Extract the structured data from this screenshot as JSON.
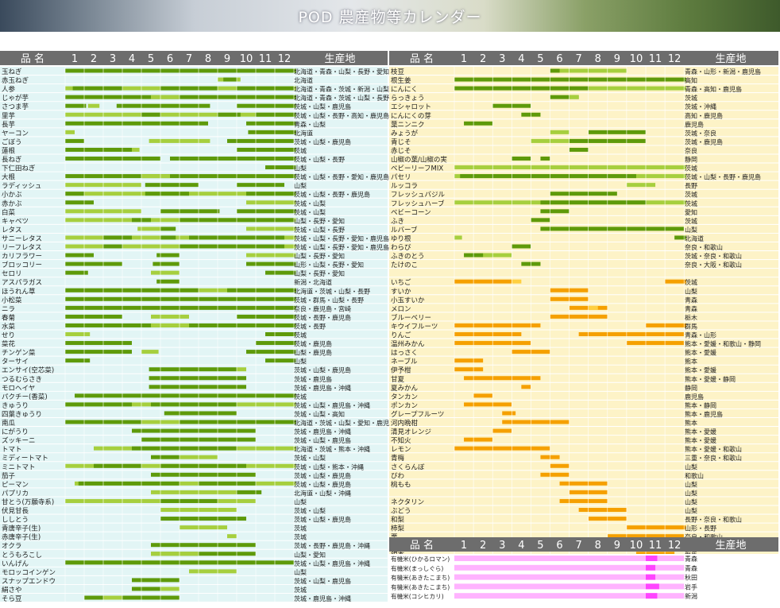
{
  "title": "POD 農産物等カレンダー",
  "headers": {
    "item": "品 名",
    "months": [
      "1",
      "2",
      "3",
      "4",
      "5",
      "6",
      "7",
      "8",
      "9",
      "10",
      "11",
      "12"
    ],
    "origin": "生産地"
  },
  "colors": {
    "dark": "#5e9a0a",
    "light": "#a6cf3e",
    "orange_dark": "#f5a000",
    "orange_light": "#ffcf40",
    "pink": "#ff44ff",
    "pink_stripe": "#ffb3ff",
    "header_bg": "#6d6d6d",
    "teal_row": "#e2f5f5",
    "cream_row": "#fdf3c7"
  },
  "left": [
    {
      "name": "玉ねぎ",
      "origin": "北海道・青森・山梨・長野・愛知・鹿児島"
    },
    {
      "name": "赤玉ねぎ",
      "origin": "北海道"
    },
    {
      "name": "人参",
      "origin": "北海道・青森・茨城・新潟・山梨・長野・鹿児島"
    },
    {
      "name": "じゃが芋",
      "origin": "北海道・青森・茨城・山梨・長野・愛知・鹿児島"
    },
    {
      "name": "さつま芋",
      "origin": "茨城・山梨・鹿児島"
    },
    {
      "name": "里芋",
      "origin": "茨城・山梨・長野・高知・鹿児島"
    },
    {
      "name": "長芋",
      "origin": "青森・山梨"
    },
    {
      "name": "ヤーコン",
      "origin": "北海道"
    },
    {
      "name": "ごぼう",
      "origin": "茨城・山梨・鹿児島"
    },
    {
      "name": "蓮根",
      "origin": "茨城"
    },
    {
      "name": "長ねぎ",
      "origin": "茨城・山梨・長野"
    },
    {
      "name": "下仁田ねぎ",
      "origin": "山梨"
    },
    {
      "name": "大根",
      "origin": "茨城・山梨・長野・愛知・鹿児島"
    },
    {
      "name": "ラディッシュ",
      "origin": "山梨"
    },
    {
      "name": "小かぶ",
      "origin": "茨城・山梨・長野・鹿児島"
    },
    {
      "name": "赤かぶ",
      "origin": "茨城・山梨"
    },
    {
      "name": "白菜",
      "origin": "茨城・山梨"
    },
    {
      "name": "キャベツ",
      "origin": "山梨・長野・愛知"
    },
    {
      "name": "レタス",
      "origin": "茨城・山梨・長野"
    },
    {
      "name": "サニーレタス",
      "origin": "茨城・山梨・長野・愛知・鹿児島"
    },
    {
      "name": "リーフレタス",
      "origin": "茨城・山梨・長野・愛知・鹿児島"
    },
    {
      "name": "カリフラワー",
      "origin": "山梨・長野・愛知"
    },
    {
      "name": "ブロッコリー",
      "origin": "山形・山梨・長野・愛知"
    },
    {
      "name": "セロリ",
      "origin": "山梨・長野・愛知"
    },
    {
      "name": "アスパラガス",
      "origin": "新潟・北海道"
    },
    {
      "name": "ほうれん草",
      "origin": "北海道・茨城・山梨・長野"
    },
    {
      "name": "小松菜",
      "origin": "茨城・群馬・山梨・長野"
    },
    {
      "name": "ニラ",
      "origin": "奈良・鹿児島・宮崎"
    },
    {
      "name": "春菊",
      "origin": "茨城・長野・鹿児島"
    },
    {
      "name": "水菜",
      "origin": "茨城・長野"
    },
    {
      "name": "せり",
      "origin": "茨城"
    },
    {
      "name": "菜花",
      "origin": "茨城・鹿児島"
    },
    {
      "name": "チンゲン菜",
      "origin": "山梨・鹿児島"
    },
    {
      "name": "ターサイ",
      "origin": "山梨"
    },
    {
      "name": "エンサイ(空芯菜)",
      "origin": "茨城・山梨・鹿児島"
    },
    {
      "name": "つるむらさき",
      "origin": "茨城・鹿児島"
    },
    {
      "name": "モロヘイヤ",
      "origin": "茨城・鹿児島・沖縄"
    },
    {
      "name": "パクチー(香菜)",
      "origin": "茨城"
    },
    {
      "name": "きゅうり",
      "origin": "茨城・山梨・鹿児島・沖縄"
    },
    {
      "name": "四葉きゅうり",
      "origin": "茨城・山梨・高知"
    },
    {
      "name": "南瓜",
      "origin": "北海道・茨城・山梨・愛知・鹿児島"
    },
    {
      "name": "にがうり",
      "origin": "茨城・鹿児島・沖縄"
    },
    {
      "name": "ズッキーニ",
      "origin": "茨城・山梨・鹿児島"
    },
    {
      "name": "トマト",
      "origin": "北海道・茨城・熊本・沖縄"
    },
    {
      "name": "ミディートマト",
      "origin": "茨城・山梨"
    },
    {
      "name": "ミニトマト",
      "origin": "茨城・山梨・熊本・沖縄"
    },
    {
      "name": "茄子",
      "origin": "茨城・山梨・鹿児島"
    },
    {
      "name": "ピーマン",
      "origin": "茨城・山梨・鹿児島"
    },
    {
      "name": "パプリカ",
      "origin": "北海道・山梨・沖縄"
    },
    {
      "name": "甘とう(万願寺系)",
      "origin": "山梨"
    },
    {
      "name": "伏見甘長",
      "origin": "茨城・山梨"
    },
    {
      "name": "ししとう",
      "origin": "茨城・山梨・鹿児島"
    },
    {
      "name": "青唐辛子(生)",
      "origin": "茨城"
    },
    {
      "name": "赤唐辛子(生)",
      "origin": "茨城"
    },
    {
      "name": "オクラ",
      "origin": "茨城・長野・鹿児島・沖縄"
    },
    {
      "name": "とうもろこし",
      "origin": "山梨・愛知"
    },
    {
      "name": "いんげん",
      "origin": "茨城・山梨・鹿児島・沖縄"
    },
    {
      "name": "モロッコインゲン",
      "origin": "山梨"
    },
    {
      "name": "スナップエンドウ",
      "origin": "茨城・山梨・鹿児島"
    },
    {
      "name": "絹さや",
      "origin": "茨城"
    },
    {
      "name": "そら豆",
      "origin": "茨城・鹿児島・沖縄"
    }
  ],
  "right": [
    {
      "name": "枝豆",
      "origin": "青森・山形・新潟・鹿児島"
    },
    {
      "name": "根生姜",
      "origin": "高知"
    },
    {
      "name": "にんにく",
      "origin": "青森・高知・鹿児島"
    },
    {
      "name": "らっきょう",
      "origin": "茨城"
    },
    {
      "name": "エシャロット",
      "origin": "茨城・沖縄"
    },
    {
      "name": "にんにくの芽",
      "origin": "高知・鹿児島"
    },
    {
      "name": "葉ニンニク",
      "origin": "鹿児島"
    },
    {
      "name": "みょうが",
      "origin": "茨城・奈良"
    },
    {
      "name": "青じそ",
      "origin": "茨城・鹿児島"
    },
    {
      "name": "赤じそ",
      "origin": "奈良"
    },
    {
      "name": "山椒の葉/山椒の実",
      "origin": "静岡"
    },
    {
      "name": "ベビーリーフMIX",
      "origin": "茨城"
    },
    {
      "name": "パセリ",
      "origin": "茨城・山梨・長野・鹿児島"
    },
    {
      "name": "ルッコラ",
      "origin": "長野"
    },
    {
      "name": "フレッシュバジル",
      "origin": "茨城"
    },
    {
      "name": "フレッシュハーブ",
      "origin": "茨城"
    },
    {
      "name": "ベビーコーン",
      "origin": "愛知"
    },
    {
      "name": "ふき",
      "origin": "茨城"
    },
    {
      "name": "ルバーブ",
      "origin": "山梨"
    },
    {
      "name": "ゆり根",
      "origin": "北海道"
    },
    {
      "name": "わらび",
      "origin": "奈良・和歌山"
    },
    {
      "name": "ふきのとう",
      "origin": "茨城・奈良・和歌山"
    },
    {
      "name": "たけのこ",
      "origin": "奈良・大阪・和歌山"
    },
    {
      "name": "",
      "origin": ""
    },
    {
      "name": "いちご",
      "origin": "茨城"
    },
    {
      "name": "すいか",
      "origin": "山梨"
    },
    {
      "name": "小玉すいか",
      "origin": "青森"
    },
    {
      "name": "メロン",
      "origin": "青森"
    },
    {
      "name": "ブルーベリー",
      "origin": "栃木"
    },
    {
      "name": "キウイフルーツ",
      "origin": "群馬"
    },
    {
      "name": "りんご",
      "origin": "青森・山形"
    },
    {
      "name": "温州みかん",
      "origin": "熊本・愛媛・和歌山・静岡"
    },
    {
      "name": "はっさく",
      "origin": "熊本・愛媛"
    },
    {
      "name": "ネーブル",
      "origin": "熊本"
    },
    {
      "name": "伊予柑",
      "origin": "熊本・愛媛"
    },
    {
      "name": "甘夏",
      "origin": "熊本・愛媛・静岡"
    },
    {
      "name": "夏みかん",
      "origin": "静岡"
    },
    {
      "name": "タンカン",
      "origin": "鹿児島"
    },
    {
      "name": "ポンカン",
      "origin": "熊本・静岡"
    },
    {
      "name": "グレープフルーツ",
      "origin": "熊本・鹿児島"
    },
    {
      "name": "河内晩柑",
      "origin": "熊本"
    },
    {
      "name": "清見オレンジ",
      "origin": "熊本・愛媛"
    },
    {
      "name": "不知火",
      "origin": "熊本・愛媛"
    },
    {
      "name": "レモン",
      "origin": "熊本・愛媛・和歌山"
    },
    {
      "name": "青梅",
      "origin": "三重・奈良・和歌山"
    },
    {
      "name": "さくらんぼ",
      "origin": "山梨"
    },
    {
      "name": "びわ",
      "origin": "和歌山"
    },
    {
      "name": "桃もも",
      "origin": "山梨"
    },
    {
      "name": "",
      "origin": "山梨"
    },
    {
      "name": "ネクタリン",
      "origin": "山梨"
    },
    {
      "name": "ぶどう",
      "origin": "山梨"
    },
    {
      "name": "和梨",
      "origin": "長野・奈良・和歌山"
    },
    {
      "name": "柿梨",
      "origin": "山形・長野"
    },
    {
      "name": "栗",
      "origin": "奈良・和歌山"
    },
    {
      "name": "",
      "origin": "茨城"
    },
    {
      "name": "銀杏",
      "origin": "群馬"
    }
  ],
  "rice": [
    {
      "name": "有機米(ひかるロマン)",
      "origin": "青森"
    },
    {
      "name": "有機米(まっしぐら)",
      "origin": "青森"
    },
    {
      "name": "有機米(あきたこまち)",
      "origin": "秋田"
    },
    {
      "name": "有機米(あきたこまち)",
      "origin": "岩手"
    },
    {
      "name": "有機米(コシヒカリ)",
      "origin": "新潟"
    }
  ]
}
